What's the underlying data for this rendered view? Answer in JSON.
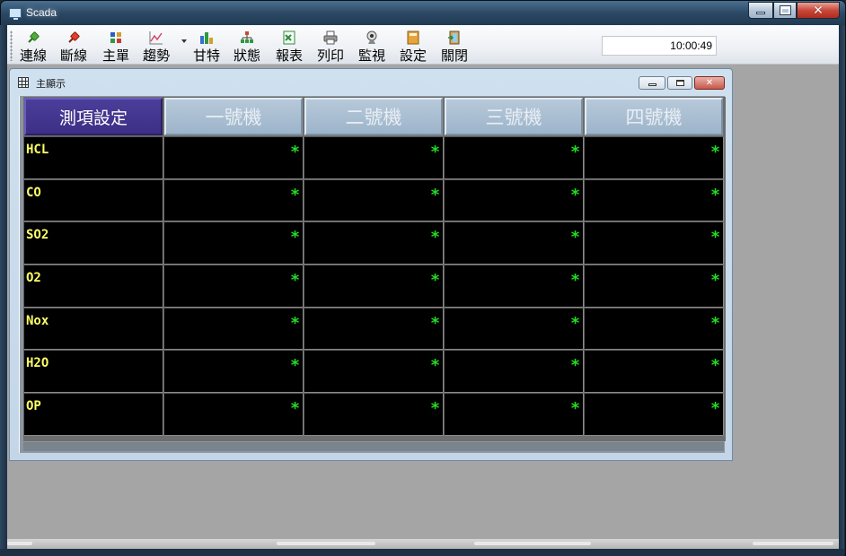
{
  "window": {
    "title": "Scada",
    "controls": {
      "minimize": "minimize",
      "maximize": "maximize",
      "close": "close"
    }
  },
  "toolbar": {
    "items": [
      {
        "label": "連線",
        "icon": "connect-plug-icon",
        "color": "#3a8a2a"
      },
      {
        "label": "斷線",
        "icon": "disconnect-plug-icon",
        "color": "#d23a2a"
      },
      {
        "label": "主單",
        "icon": "grid-menu-icon",
        "color": "#3a6ad0"
      },
      {
        "label": "趨勢",
        "icon": "trend-chart-icon",
        "color": "#d24a6a"
      },
      {
        "label": "甘特",
        "icon": "bar-chart-icon",
        "color": "#3a70c8"
      },
      {
        "label": "狀態",
        "icon": "org-chart-icon",
        "color": "#c84a2a"
      },
      {
        "label": "報表",
        "icon": "spreadsheet-icon",
        "color": "#2e8a3a"
      },
      {
        "label": "列印",
        "icon": "printer-icon",
        "color": "#555555"
      },
      {
        "label": "監視",
        "icon": "webcam-icon",
        "color": "#666666"
      },
      {
        "label": "設定",
        "icon": "notebook-icon",
        "color": "#c8862a"
      },
      {
        "label": "關閉",
        "icon": "exit-door-icon",
        "color": "#8a6a3a"
      }
    ],
    "clock": "10:00:49"
  },
  "child_window": {
    "title": "主顯示"
  },
  "table": {
    "headers": [
      "測項設定",
      "一號機",
      "二號機",
      "三號機",
      "四號機"
    ],
    "rows": [
      {
        "label": "HCL",
        "values": [
          "*",
          "*",
          "*",
          "*"
        ]
      },
      {
        "label": "CO",
        "values": [
          "*",
          "*",
          "*",
          "*"
        ]
      },
      {
        "label": "SO2",
        "values": [
          "*",
          "*",
          "*",
          "*"
        ]
      },
      {
        "label": "O2",
        "values": [
          "*",
          "*",
          "*",
          "*"
        ]
      },
      {
        "label": "Nox",
        "values": [
          "*",
          "*",
          "*",
          "*"
        ]
      },
      {
        "label": "H2O",
        "values": [
          "*",
          "*",
          "*",
          "*"
        ]
      },
      {
        "label": "OP",
        "values": [
          "*",
          "*",
          "*",
          "*"
        ]
      }
    ]
  },
  "colors": {
    "header_first_bg": "#3d2f86",
    "header_bg": "#9db4ca",
    "label_text": "#ffff66",
    "value_text": "#22dd22",
    "cell_bg": "#000000"
  }
}
